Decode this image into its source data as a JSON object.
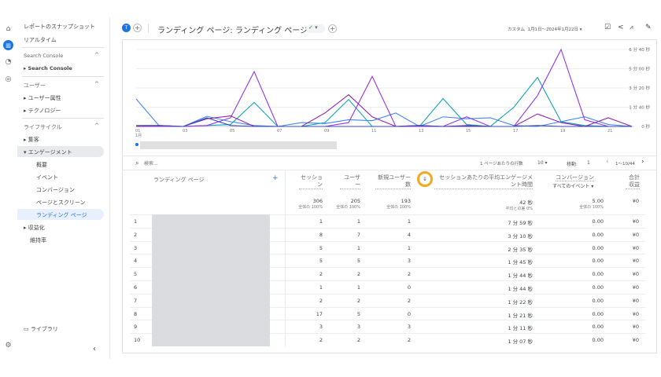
{
  "rail": {
    "icons": [
      "home-icon",
      "reports-icon",
      "explore-icon",
      "advertising-icon"
    ],
    "settings_icon": "gear-icon"
  },
  "nav": {
    "snapshot": "レポートのスナップショット",
    "realtime": "リアルタイム",
    "search_console_section": "Search Console",
    "search_console_item": "Search Console",
    "user_section": "ユーザー",
    "user_attr": "ユーザー属性",
    "tech": "テクノロジー",
    "lifecycle_section": "ライフサイクル",
    "acquisition": "集客",
    "engagement": "エンゲージメント",
    "overview": "概要",
    "events": "イベント",
    "conversions": "コンバージョン",
    "pages": "ページとスクリーン",
    "landing": "ランディング ページ",
    "monetization": "収益化",
    "retention": "維持率",
    "library": "ライブラリ"
  },
  "header": {
    "avatar": "T",
    "title": "ランディング ページ: ランディング ページ",
    "date_label": "カスタム",
    "date_range": "1月1日～2024年1月22日"
  },
  "chart_data": {
    "type": "line",
    "x": [
      "01",
      "02",
      "03",
      "04",
      "05",
      "06",
      "07",
      "08",
      "09",
      "10",
      "11",
      "12",
      "13",
      "14",
      "15",
      "16",
      "17",
      "18",
      "19",
      "20",
      "21",
      "22"
    ],
    "xtick_labels": [
      "01",
      "03",
      "05",
      "07",
      "09",
      "11",
      "13",
      "15",
      "17",
      "19",
      "21"
    ],
    "x_month": "1月",
    "ytick_labels": [
      "0 秒",
      "1 分 40 秒",
      "3 分 20 秒",
      "5 分 00 秒",
      "6 分 40 秒"
    ],
    "ylim_seconds": [
      0,
      400
    ],
    "grid": true,
    "series": [
      {
        "color": "#4285f4",
        "values": [
          143,
          0,
          0,
          53,
          25,
          5,
          0,
          20,
          15,
          35,
          30,
          70,
          0,
          50,
          40,
          45,
          5,
          0,
          25,
          50,
          10,
          0
        ]
      },
      {
        "color": "#12a4b6",
        "values": [
          0,
          0,
          0,
          5,
          10,
          125,
          0,
          0,
          20,
          140,
          0,
          0,
          0,
          145,
          10,
          0,
          100,
          255,
          25,
          5,
          0,
          0
        ]
      },
      {
        "color": "#9334e6",
        "values": [
          0,
          0,
          0,
          5,
          45,
          285,
          0,
          0,
          0,
          20,
          260,
          0,
          0,
          0,
          50,
          0,
          0,
          160,
          400,
          35,
          0,
          0
        ]
      },
      {
        "color": "#8e24aa",
        "values": [
          0,
          5,
          0,
          40,
          55,
          0,
          0,
          0,
          70,
          165,
          50,
          0,
          5,
          0,
          5,
          0,
          0,
          65,
          20,
          0,
          45,
          0
        ]
      },
      {
        "color": "#3949ab",
        "values": [
          5,
          5,
          0,
          45,
          5,
          0,
          0,
          0,
          0,
          0,
          0,
          0,
          5,
          0,
          0,
          0,
          0,
          5,
          0,
          0,
          0,
          0
        ]
      }
    ]
  },
  "table": {
    "search_placeholder": "検索...",
    "rows_per_page_label": "1 ページあたりの行数",
    "rows_per_page": "10",
    "goto_label": "移動:",
    "goto_value": "1",
    "range": "1～10/44",
    "columns": {
      "landing": "ランディング ページ",
      "sessions": "セッション",
      "users": "ユーザー",
      "new_users": "新規ユーザー数",
      "avg_time": "セッションあたりの平均エンゲージメント時間",
      "conversions": "コンバージョン",
      "conv_filter": "すべてのイベント",
      "revenue": "合計収益"
    },
    "totals": {
      "sessions": "306",
      "sessions_sub": "全体の 100%",
      "users": "205",
      "users_sub": "全体の 100%",
      "new_users": "193",
      "new_users_sub": "全体の 100%",
      "avg_time": "42 秒",
      "avg_time_sub": "平均との差 0%",
      "conversions": "5.00",
      "conversions_sub": "全体の 100%",
      "revenue": "¥0"
    },
    "rows": [
      [
        "1",
        "1",
        "1",
        "1",
        "7 分 59 秒",
        "0.00",
        "¥0"
      ],
      [
        "2",
        "8",
        "7",
        "4",
        "3 分 10 秒",
        "0.00",
        "¥0"
      ],
      [
        "3",
        "5",
        "1",
        "1",
        "2 分 35 秒",
        "0.00",
        "¥0"
      ],
      [
        "4",
        "5",
        "5",
        "3",
        "1 分 45 秒",
        "0.00",
        "¥0"
      ],
      [
        "5",
        "2",
        "2",
        "2",
        "1 分 44 秒",
        "0.00",
        "¥0"
      ],
      [
        "6",
        "1",
        "1",
        "0",
        "1 分 44 秒",
        "0.00",
        "¥0"
      ],
      [
        "7",
        "2",
        "2",
        "2",
        "1 分 22 秒",
        "0.00",
        "¥0"
      ],
      [
        "8",
        "17",
        "5",
        "0",
        "1 分 21 秒",
        "0.00",
        "¥0"
      ],
      [
        "9",
        "3",
        "3",
        "3",
        "1 分 11 秒",
        "0.00",
        "¥0"
      ],
      [
        "10",
        "2",
        "2",
        "2",
        "1 分 07 秒",
        "0.00",
        "¥0"
      ]
    ]
  },
  "colors": {
    "accent": "#1a73e8",
    "highlight_ring": "#f4a81d"
  }
}
